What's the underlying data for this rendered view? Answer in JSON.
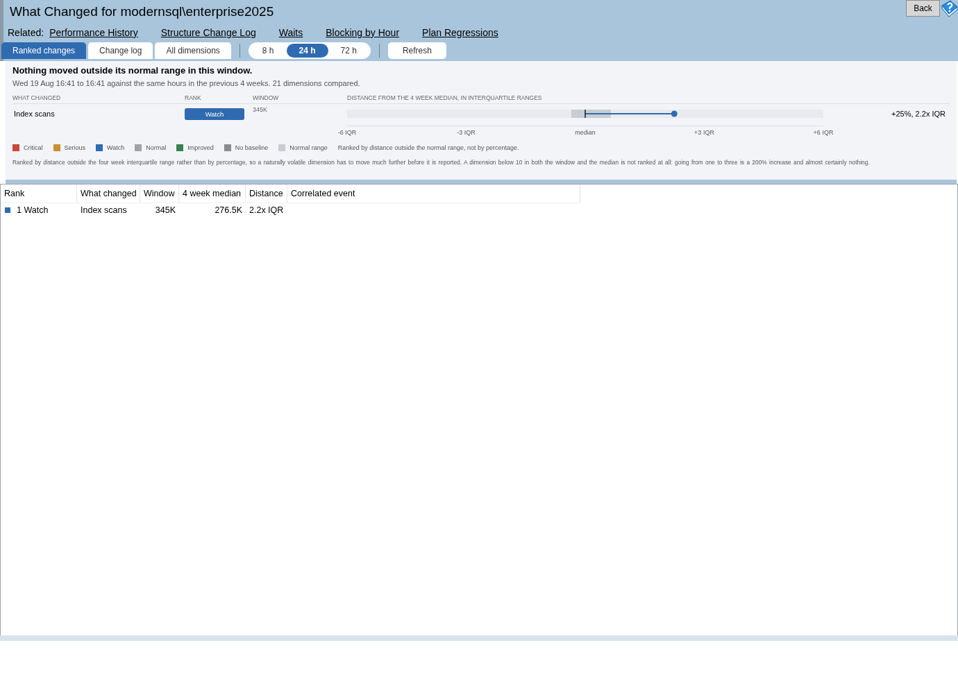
{
  "window": {
    "title": "What Changed for modernsql\\enterprise2025",
    "back_button": "Back"
  },
  "related": {
    "label": "Related:",
    "links": [
      "Performance History",
      "Structure Change Log",
      "Waits",
      "Blocking by Hour",
      "Plan Regressions"
    ]
  },
  "view_tabs": [
    {
      "label": "Ranked changes",
      "selected": true
    },
    {
      "label": "Change log",
      "selected": false
    },
    {
      "label": "All dimensions",
      "selected": false
    }
  ],
  "range_tabs": [
    {
      "label": "8 h",
      "selected": false
    },
    {
      "label": "24 h",
      "selected": true
    },
    {
      "label": "72 h",
      "selected": false
    }
  ],
  "refresh_button": "Refresh",
  "summary": {
    "headline": "Nothing moved outside its normal range in this window.",
    "detail": "Wed 19 Aug 16:41 to 16:41 against the same hours in the previous 4 weeks. 21 dimensions compared."
  },
  "distance_table": {
    "columns": [
      "WHAT CHANGED",
      "RANK",
      "WINDOW",
      "DISTANCE FROM THE 4 WEEK MEDIAN, IN INTERQUARTILE RANGES"
    ],
    "rows": [
      {
        "what_changed": "Index scans",
        "rank": "Watch",
        "color": "#2e6bb0",
        "window": "345K",
        "level": 0.687,
        "reading": "+25%, 2.2x IQR"
      }
    ],
    "axis_labels": [
      "-6 IQR",
      "-3 IQR",
      "median",
      "+3 IQR",
      "+6 IQR"
    ]
  },
  "legend": {
    "items": [
      {
        "label": "Critical",
        "color": "#c9483c"
      },
      {
        "label": "Serious",
        "color": "#c98f32"
      },
      {
        "label": "Watch",
        "color": "#2e6bb0"
      },
      {
        "label": "Normal",
        "color": "#a0a2a8"
      },
      {
        "label": "Improved",
        "color": "#3a8150"
      },
      {
        "label": "No baseline",
        "color": "#888a90"
      },
      {
        "label": "Normal range",
        "color": "#c8ccd4"
      }
    ],
    "note": "Ranked by distance outside the normal range, not by percentage."
  },
  "footnote": "Ranked by distance outside the four week interquartile range rather than by percentage, so a naturally volatile dimension has to move much further before it is reported.   A dimension below 10 in both the window and the median is not ranked at all: going from one to three is a 200% increase and almost certainly nothing.",
  "grid": {
    "columns": [
      "Rank",
      "What changed",
      "Window",
      "4 week median",
      "Distance",
      "Correlated event"
    ],
    "rows": [
      {
        "color": "#2e6bb0",
        "cells": [
          "1 Watch",
          "Index scans",
          "345K",
          "276.5K",
          "2.2x IQR"
        ]
      }
    ]
  }
}
